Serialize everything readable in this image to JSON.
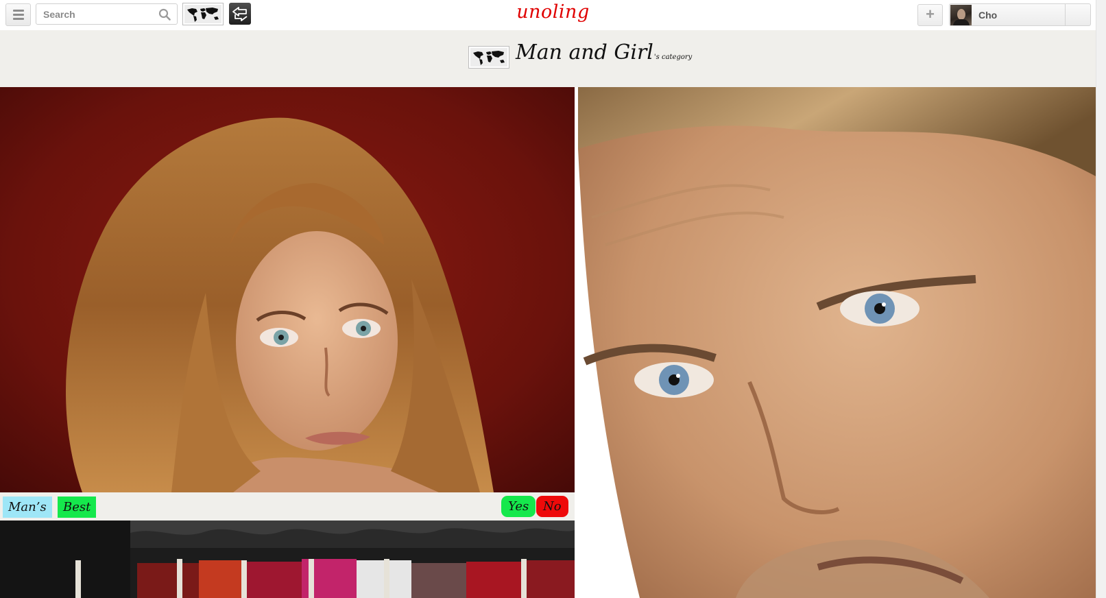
{
  "topbar": {
    "search_placeholder": "Search",
    "logo": "unoling",
    "add_label": "+",
    "username": "Cho"
  },
  "category": {
    "title": "Man and Girl",
    "suffix": "'s category"
  },
  "left_card": {
    "tags": [
      "Man’s",
      "Best"
    ],
    "yes_label": "Yes",
    "no_label": "No"
  },
  "colors": {
    "brand": "#e00000",
    "tag_blue": "#9ee6f7",
    "tag_green": "#15e84c",
    "vote_yes": "#15e84c",
    "vote_no": "#ee0a0a",
    "band": "#f0efeb"
  },
  "icons": {
    "menu": "menu-icon",
    "search": "search-icon",
    "world_map": "world-map-icon",
    "share": "share-arrows-icon",
    "add": "plus-icon"
  }
}
